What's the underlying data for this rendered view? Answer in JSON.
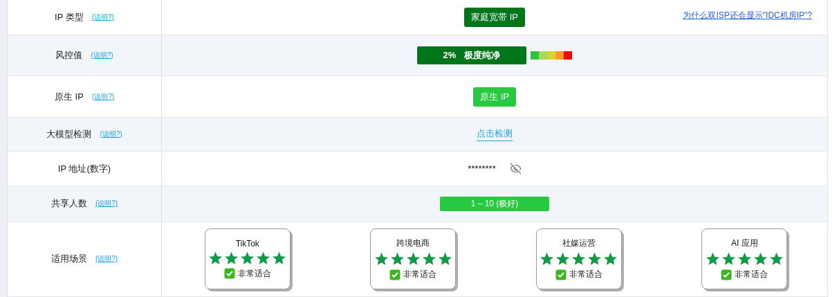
{
  "rows": [
    {
      "kind": "badge",
      "label": "IP 类型",
      "help": "(说明?)",
      "value": "家庭宽带 IP",
      "color": "#00761a",
      "link": "为什么双ISP还会显示\"IDC机房IP\"?"
    },
    {
      "kind": "meter",
      "label": "风控值",
      "help": "(说明?)",
      "percent": "2%",
      "value": "极度纯净"
    },
    {
      "kind": "badge",
      "label": "原生 IP",
      "help": "(说明?)",
      "value": "原生 IP",
      "color": "#28c840"
    },
    {
      "kind": "link",
      "label": "大模型检测",
      "help": "(说明?)",
      "value": "点击检测"
    },
    {
      "kind": "masked",
      "label": "IP 地址(数字)",
      "value": "********"
    },
    {
      "kind": "bar",
      "label": "共享人数",
      "help": "(说明?)",
      "value": "1 – 10 (极好)"
    },
    {
      "kind": "scenarios",
      "label": "适用场景",
      "help": "(说明?)",
      "scenarios": [
        {
          "name": "TikTok",
          "stars": 5,
          "verdict": "非常适合"
        },
        {
          "name": "跨境电商",
          "stars": 5,
          "verdict": "非常适合"
        },
        {
          "name": "社媒运营",
          "stars": 5,
          "verdict": "非常适合"
        },
        {
          "name": "AI 应用",
          "stars": 5,
          "verdict": "非常适合"
        }
      ]
    }
  ]
}
